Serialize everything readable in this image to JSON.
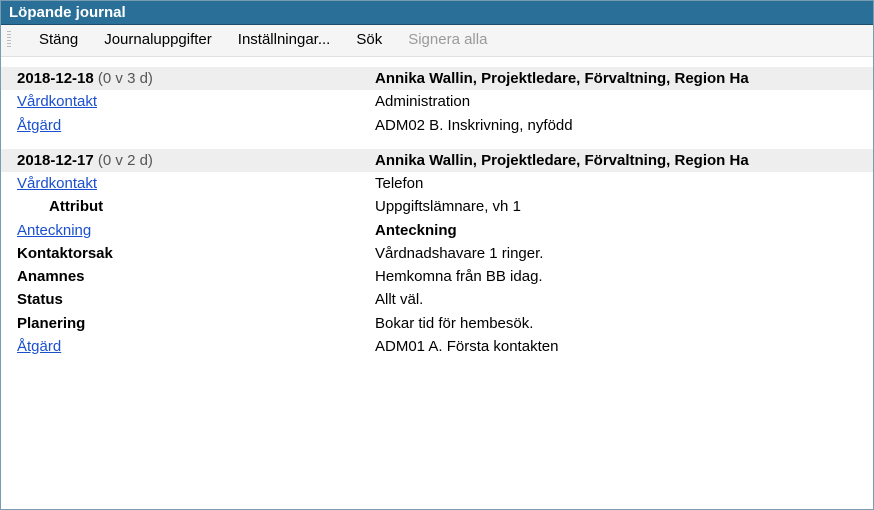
{
  "window": {
    "title": "Löpande journal"
  },
  "menu": {
    "close": "Stäng",
    "journal": "Journaluppgifter",
    "settings": "Inställningar...",
    "search": "Sök",
    "sign_all": "Signera alla"
  },
  "entries": [
    {
      "date": "2018-12-18",
      "age": "(0 v 3 d)",
      "author": "Annika Wallin, Projektledare, Förvaltning, Region Ha",
      "rows": [
        {
          "left_text": "Vårdkontakt",
          "left_class": "link",
          "right": "Administration"
        },
        {
          "left_text": "Åtgärd",
          "left_class": "link",
          "right": "ADM02 B. Inskrivning, nyfödd"
        }
      ]
    },
    {
      "date": "2018-12-17",
      "age": "(0 v 2 d)",
      "author": "Annika Wallin, Projektledare, Förvaltning, Region Ha",
      "rows": [
        {
          "left_text": "Vårdkontakt",
          "left_class": "link",
          "right": "Telefon"
        },
        {
          "left_text": "Attribut",
          "left_class": "indent bold",
          "right": "Uppgiftslämnare, vh 1"
        },
        {
          "left_text": "Anteckning",
          "left_class": "link",
          "right": "Anteckning",
          "right_class": "bold"
        },
        {
          "left_text": "Kontaktorsak",
          "left_class": "bold",
          "right": "Vårdnadshavare 1 ringer."
        },
        {
          "left_text": "Anamnes",
          "left_class": "bold",
          "right": "Hemkomna från BB idag."
        },
        {
          "left_text": "Status",
          "left_class": "bold",
          "right": "Allt väl."
        },
        {
          "left_text": "Planering",
          "left_class": "bold",
          "right": "Bokar tid för hembesök."
        },
        {
          "left_text": "Åtgärd",
          "left_class": "link",
          "right": "ADM01 A. Första kontakten"
        }
      ]
    }
  ]
}
